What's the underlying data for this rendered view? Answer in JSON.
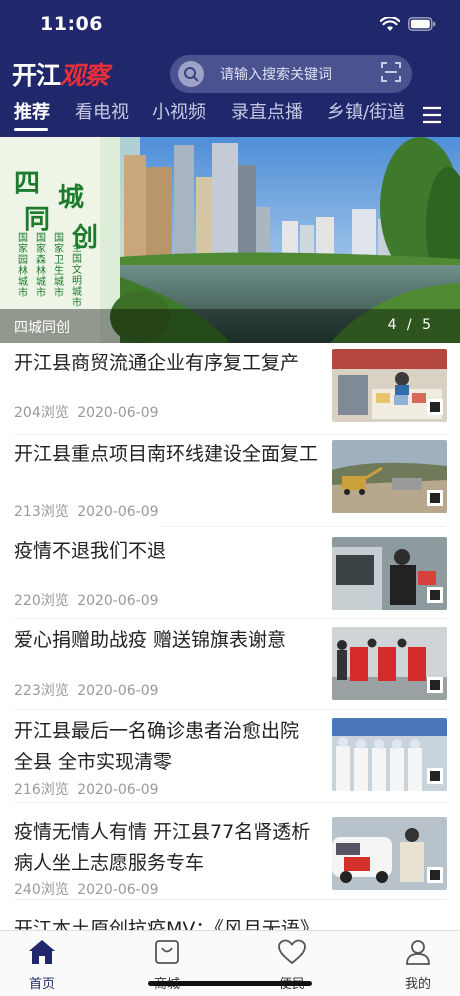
{
  "status_bar": {
    "time": "11:06"
  },
  "logo": {
    "part1": "开江",
    "part2": "观察"
  },
  "search": {
    "placeholder": "请输入搜索关键词"
  },
  "tabs": [
    {
      "label": "推荐",
      "active": true
    },
    {
      "label": "看电视",
      "active": false
    },
    {
      "label": "小视频",
      "active": false
    },
    {
      "label": "录直点播",
      "active": false
    },
    {
      "label": "乡镇/街道",
      "active": false
    }
  ],
  "banner": {
    "caption": "四城同创",
    "current": 4,
    "total": 5,
    "index_text": "4 / 5",
    "heading_chars": [
      "四",
      "城",
      "同",
      "创"
    ],
    "columns": [
      "国家园林城市",
      "国家森林城市",
      "国家卫生城市",
      "全国文明城市"
    ]
  },
  "news": [
    {
      "title": "开江县商贸流通企业有序复工复产",
      "views": "204浏览",
      "date": "2020-06-09",
      "thumb": "shop-icon"
    },
    {
      "title": "开江县重点项目南环线建设全面复工",
      "views": "213浏览",
      "date": "2020-06-09",
      "thumb": "construction-icon"
    },
    {
      "title": "疫情不退我们不退",
      "views": "220浏览",
      "date": "2020-06-09",
      "thumb": "checkpoint-icon"
    },
    {
      "title": "爱心捐赠助战疫 赠送锦旗表谢意",
      "views": "223浏览",
      "date": "2020-06-09",
      "thumb": "banners-icon"
    },
    {
      "title": "开江县最后一名确诊患者治愈出院 全县 全市实现清零",
      "views": "216浏览",
      "date": "2020-06-09",
      "thumb": "medical-staff-icon"
    },
    {
      "title": "疫情无情人有情 开江县77名肾透析病人坐上志愿服务专车",
      "views": "240浏览",
      "date": "2020-06-09",
      "thumb": "volunteer-car-icon"
    },
    {
      "title": "开江本土原创抗疫MV：《风月无语》",
      "views": "",
      "date": "",
      "thumb": ""
    }
  ],
  "tabbar": [
    {
      "label": "首页",
      "icon": "home-icon",
      "active": true
    },
    {
      "label": "商城",
      "icon": "shop-bag-icon",
      "active": false
    },
    {
      "label": "便民",
      "icon": "heart-icon",
      "active": false
    },
    {
      "label": "我的",
      "icon": "person-icon",
      "active": false
    }
  ],
  "colors": {
    "header": "#20286b",
    "accent_red": "#e8303a",
    "active_tab": "#20286b"
  }
}
